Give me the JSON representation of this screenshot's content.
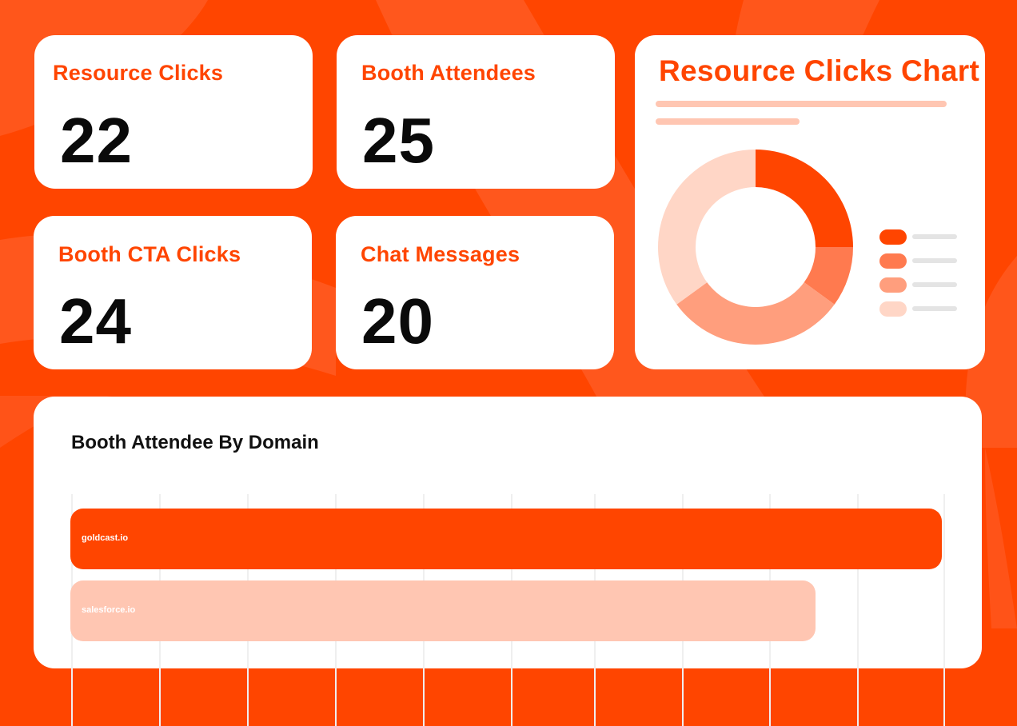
{
  "colors": {
    "brand": "#ff4500",
    "brand_light": "#ffc6b2",
    "card_bg": "#ffffff",
    "donut": [
      "#ff4500",
      "#ff7a4f",
      "#ff9e7d",
      "#ffd6c6"
    ]
  },
  "stats": [
    {
      "label": "Resource Clicks",
      "value": "22"
    },
    {
      "label": "Booth Attendees",
      "value": "25"
    },
    {
      "label": "Booth CTA Clicks",
      "value": "24"
    },
    {
      "label": "Chat Messages",
      "value": "20"
    }
  ],
  "donut_card": {
    "title": "Resource Clicks Chart"
  },
  "bar_card": {
    "title": "Booth Attendee By Domain"
  },
  "chart_data": [
    {
      "type": "pie",
      "values": [
        25,
        10,
        30,
        35
      ],
      "colors": [
        "#ff4500",
        "#ff7a4f",
        "#ff9e7d",
        "#ffd6c6"
      ]
    },
    {
      "type": "bar",
      "orientation": "horizontal",
      "categories": [
        "goldcast.io",
        "salesforce.io"
      ],
      "values": [
        10,
        8.55
      ],
      "xlim": [
        0,
        10
      ],
      "colors": [
        "#ff4500",
        "#ffc6b2"
      ]
    }
  ]
}
